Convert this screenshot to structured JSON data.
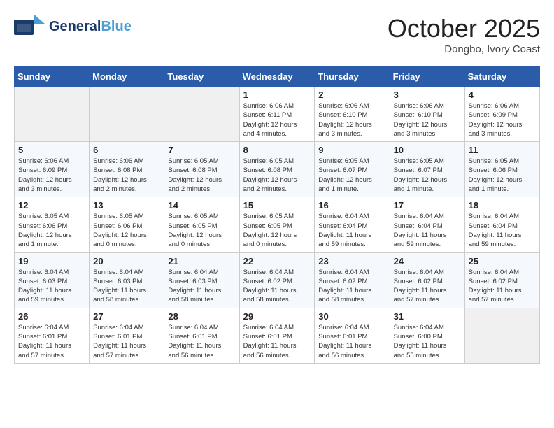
{
  "header": {
    "logo": {
      "brand_general": "General",
      "brand_blue": "Blue"
    },
    "title": "October 2025",
    "location": "Dongbo, Ivory Coast"
  },
  "days_of_week": [
    "Sunday",
    "Monday",
    "Tuesday",
    "Wednesday",
    "Thursday",
    "Friday",
    "Saturday"
  ],
  "weeks": [
    [
      {
        "day": "",
        "info": ""
      },
      {
        "day": "",
        "info": ""
      },
      {
        "day": "",
        "info": ""
      },
      {
        "day": "1",
        "info": "Sunrise: 6:06 AM\nSunset: 6:11 PM\nDaylight: 12 hours\nand 4 minutes."
      },
      {
        "day": "2",
        "info": "Sunrise: 6:06 AM\nSunset: 6:10 PM\nDaylight: 12 hours\nand 3 minutes."
      },
      {
        "day": "3",
        "info": "Sunrise: 6:06 AM\nSunset: 6:10 PM\nDaylight: 12 hours\nand 3 minutes."
      },
      {
        "day": "4",
        "info": "Sunrise: 6:06 AM\nSunset: 6:09 PM\nDaylight: 12 hours\nand 3 minutes."
      }
    ],
    [
      {
        "day": "5",
        "info": "Sunrise: 6:06 AM\nSunset: 6:09 PM\nDaylight: 12 hours\nand 3 minutes."
      },
      {
        "day": "6",
        "info": "Sunrise: 6:06 AM\nSunset: 6:08 PM\nDaylight: 12 hours\nand 2 minutes."
      },
      {
        "day": "7",
        "info": "Sunrise: 6:05 AM\nSunset: 6:08 PM\nDaylight: 12 hours\nand 2 minutes."
      },
      {
        "day": "8",
        "info": "Sunrise: 6:05 AM\nSunset: 6:08 PM\nDaylight: 12 hours\nand 2 minutes."
      },
      {
        "day": "9",
        "info": "Sunrise: 6:05 AM\nSunset: 6:07 PM\nDaylight: 12 hours\nand 1 minute."
      },
      {
        "day": "10",
        "info": "Sunrise: 6:05 AM\nSunset: 6:07 PM\nDaylight: 12 hours\nand 1 minute."
      },
      {
        "day": "11",
        "info": "Sunrise: 6:05 AM\nSunset: 6:06 PM\nDaylight: 12 hours\nand 1 minute."
      }
    ],
    [
      {
        "day": "12",
        "info": "Sunrise: 6:05 AM\nSunset: 6:06 PM\nDaylight: 12 hours\nand 1 minute."
      },
      {
        "day": "13",
        "info": "Sunrise: 6:05 AM\nSunset: 6:06 PM\nDaylight: 12 hours\nand 0 minutes."
      },
      {
        "day": "14",
        "info": "Sunrise: 6:05 AM\nSunset: 6:05 PM\nDaylight: 12 hours\nand 0 minutes."
      },
      {
        "day": "15",
        "info": "Sunrise: 6:05 AM\nSunset: 6:05 PM\nDaylight: 12 hours\nand 0 minutes."
      },
      {
        "day": "16",
        "info": "Sunrise: 6:04 AM\nSunset: 6:04 PM\nDaylight: 11 hours\nand 59 minutes."
      },
      {
        "day": "17",
        "info": "Sunrise: 6:04 AM\nSunset: 6:04 PM\nDaylight: 11 hours\nand 59 minutes."
      },
      {
        "day": "18",
        "info": "Sunrise: 6:04 AM\nSunset: 6:04 PM\nDaylight: 11 hours\nand 59 minutes."
      }
    ],
    [
      {
        "day": "19",
        "info": "Sunrise: 6:04 AM\nSunset: 6:03 PM\nDaylight: 11 hours\nand 59 minutes."
      },
      {
        "day": "20",
        "info": "Sunrise: 6:04 AM\nSunset: 6:03 PM\nDaylight: 11 hours\nand 58 minutes."
      },
      {
        "day": "21",
        "info": "Sunrise: 6:04 AM\nSunset: 6:03 PM\nDaylight: 11 hours\nand 58 minutes."
      },
      {
        "day": "22",
        "info": "Sunrise: 6:04 AM\nSunset: 6:02 PM\nDaylight: 11 hours\nand 58 minutes."
      },
      {
        "day": "23",
        "info": "Sunrise: 6:04 AM\nSunset: 6:02 PM\nDaylight: 11 hours\nand 58 minutes."
      },
      {
        "day": "24",
        "info": "Sunrise: 6:04 AM\nSunset: 6:02 PM\nDaylight: 11 hours\nand 57 minutes."
      },
      {
        "day": "25",
        "info": "Sunrise: 6:04 AM\nSunset: 6:02 PM\nDaylight: 11 hours\nand 57 minutes."
      }
    ],
    [
      {
        "day": "26",
        "info": "Sunrise: 6:04 AM\nSunset: 6:01 PM\nDaylight: 11 hours\nand 57 minutes."
      },
      {
        "day": "27",
        "info": "Sunrise: 6:04 AM\nSunset: 6:01 PM\nDaylight: 11 hours\nand 57 minutes."
      },
      {
        "day": "28",
        "info": "Sunrise: 6:04 AM\nSunset: 6:01 PM\nDaylight: 11 hours\nand 56 minutes."
      },
      {
        "day": "29",
        "info": "Sunrise: 6:04 AM\nSunset: 6:01 PM\nDaylight: 11 hours\nand 56 minutes."
      },
      {
        "day": "30",
        "info": "Sunrise: 6:04 AM\nSunset: 6:01 PM\nDaylight: 11 hours\nand 56 minutes."
      },
      {
        "day": "31",
        "info": "Sunrise: 6:04 AM\nSunset: 6:00 PM\nDaylight: 11 hours\nand 55 minutes."
      },
      {
        "day": "",
        "info": ""
      }
    ]
  ]
}
